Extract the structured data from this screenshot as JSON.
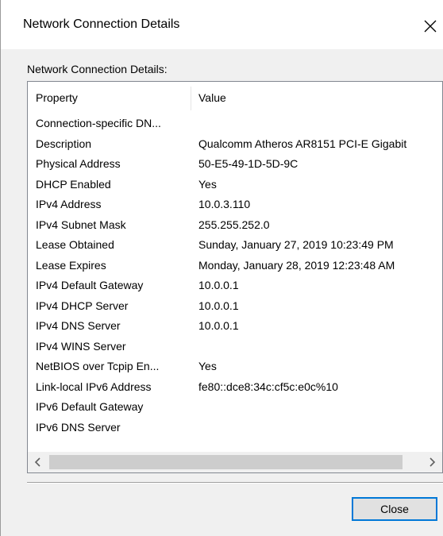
{
  "window": {
    "title": "Network Connection Details"
  },
  "group": {
    "label": "Network Connection Details:"
  },
  "table": {
    "columns": [
      "Property",
      "Value"
    ],
    "rows": [
      {
        "property": "Connection-specific DN...",
        "value": ""
      },
      {
        "property": "Description",
        "value": "Qualcomm Atheros AR8151 PCI-E Gigabit"
      },
      {
        "property": "Physical Address",
        "value": "50-E5-49-1D-5D-9C"
      },
      {
        "property": "DHCP Enabled",
        "value": "Yes"
      },
      {
        "property": "IPv4 Address",
        "value": "10.0.3.110"
      },
      {
        "property": "IPv4 Subnet Mask",
        "value": "255.255.252.0"
      },
      {
        "property": "Lease Obtained",
        "value": "Sunday, January 27, 2019 10:23:49 PM"
      },
      {
        "property": "Lease Expires",
        "value": "Monday, January 28, 2019 12:23:48 AM"
      },
      {
        "property": "IPv4 Default Gateway",
        "value": "10.0.0.1"
      },
      {
        "property": "IPv4 DHCP Server",
        "value": "10.0.0.1"
      },
      {
        "property": "IPv4 DNS Server",
        "value": "10.0.0.1"
      },
      {
        "property": "IPv4 WINS Server",
        "value": ""
      },
      {
        "property": "NetBIOS over Tcpip En...",
        "value": "Yes"
      },
      {
        "property": "Link-local IPv6 Address",
        "value": "fe80::dce8:34c:cf5c:e0c%10"
      },
      {
        "property": "IPv6 Default Gateway",
        "value": ""
      },
      {
        "property": "IPv6 DNS Server",
        "value": ""
      }
    ]
  },
  "buttons": {
    "close_label": "Close"
  },
  "colors": {
    "accent": "#0078d7",
    "dialog_bg": "#f0f0f0",
    "scroll_thumb": "#cdcdcd"
  },
  "icons": {
    "close": "close-icon",
    "scroll_left": "chevron-left-icon",
    "scroll_right": "chevron-right-icon"
  }
}
